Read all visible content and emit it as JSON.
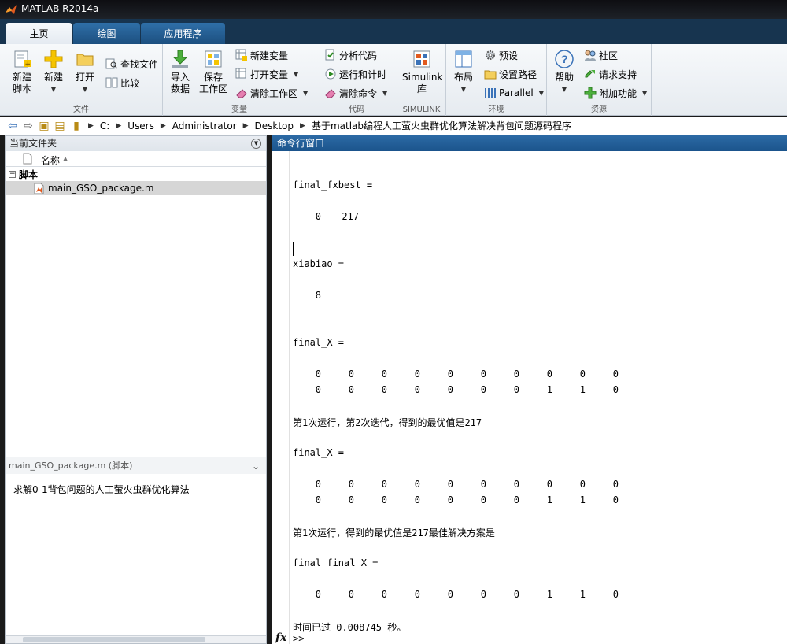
{
  "window": {
    "title": "MATLAB R2014a"
  },
  "tabs": [
    "主页",
    "绘图",
    "应用程序"
  ],
  "ribbon": {
    "file": {
      "label": "文件",
      "new_script": [
        "新建",
        "脚本"
      ],
      "new": "新建",
      "open": "打开",
      "find_files": "查找文件",
      "compare": "比较"
    },
    "variable": {
      "label": "变量",
      "import_data": [
        "导入",
        "数据"
      ],
      "save_workspace": [
        "保存",
        "工作区"
      ],
      "new_variable": "新建变量",
      "open_variable": "打开变量",
      "clear_workspace": "清除工作区"
    },
    "code": {
      "label": "代码",
      "analyze_code": "分析代码",
      "run_and_time": "运行和计时",
      "clear_commands": "清除命令"
    },
    "simulink": {
      "label": "SIMULINK",
      "library": [
        "Simulink",
        "库"
      ]
    },
    "environment": {
      "label": "环境",
      "layout": "布局",
      "preferences": "预设",
      "set_path": "设置路径",
      "parallel": "Parallel"
    },
    "resources": {
      "label": "资源",
      "help": "帮助",
      "community": "社区",
      "request_support": "请求支持",
      "add_ons": "附加功能"
    }
  },
  "address": {
    "crumbs": [
      "C:",
      "Users",
      "Administrator",
      "Desktop",
      "基于matlab编程人工萤火虫群优化算法解决背包问题源码程序"
    ]
  },
  "current_folder": {
    "title": "当前文件夹",
    "col_name": "名称",
    "section": "脚本",
    "file": "main_GSO_package.m",
    "detail_title": "main_GSO_package.m (脚本)",
    "detail_text": "求解0-1背包问题的人工萤火虫群优化算法"
  },
  "command_window": {
    "title": "命令行窗口",
    "var1": "final_fxbest =",
    "row1": [
      "0",
      "217"
    ],
    "var2": "xiabiao =",
    "val2": "8",
    "var3": "final_X =",
    "mat3_r1": [
      "0",
      "0",
      "0",
      "0",
      "0",
      "0",
      "0",
      "0",
      "0",
      "0"
    ],
    "mat3_r2": [
      "0",
      "0",
      "0",
      "0",
      "0",
      "0",
      "0",
      "1",
      "1",
      "0"
    ],
    "msg1": "第1次运行，第2次迭代，得到的最优值是217",
    "var4": "final_X =",
    "mat4_r1": [
      "0",
      "0",
      "0",
      "0",
      "0",
      "0",
      "0",
      "0",
      "0",
      "0"
    ],
    "mat4_r2": [
      "0",
      "0",
      "0",
      "0",
      "0",
      "0",
      "0",
      "1",
      "1",
      "0"
    ],
    "msg2": "第1次运行，得到的最优值是217最佳解决方案是",
    "var5": "final_final_X =",
    "mat5_r1": [
      "0",
      "0",
      "0",
      "0",
      "0",
      "0",
      "0",
      "1",
      "1",
      "0"
    ],
    "elapsed": "时间已过 0.008745 秒。",
    "fx": "fx",
    "prompt": ">>"
  },
  "colors": {
    "accent": "#1b548c",
    "titlebar": "#17344f",
    "selected_row": "#d6d6d6"
  }
}
